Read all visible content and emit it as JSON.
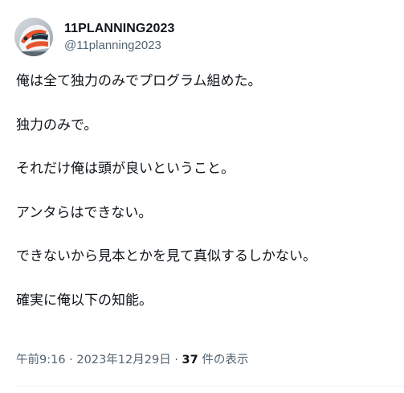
{
  "author": {
    "display_name": "11PLANNING2023",
    "handle": "@11planning2023",
    "avatar_icon": "racing-helmet-avatar"
  },
  "tweet": {
    "lines": [
      "俺は全て独力のみでプログラム組めた。",
      "",
      "独力のみで。",
      "",
      "それだけ俺は頭が良いということ。",
      "",
      "アンタらはできない。",
      "",
      "できないから見本とかを見て真似するしかない。",
      "",
      "確実に俺以下の知能。"
    ]
  },
  "meta": {
    "time": "午前9:16",
    "separator": "·",
    "date": "2023年12月29日",
    "view_count": "37",
    "view_label": "件の表示"
  },
  "colors": {
    "text": "#0f1419",
    "secondary": "#536471",
    "divider": "#eff3f4"
  }
}
